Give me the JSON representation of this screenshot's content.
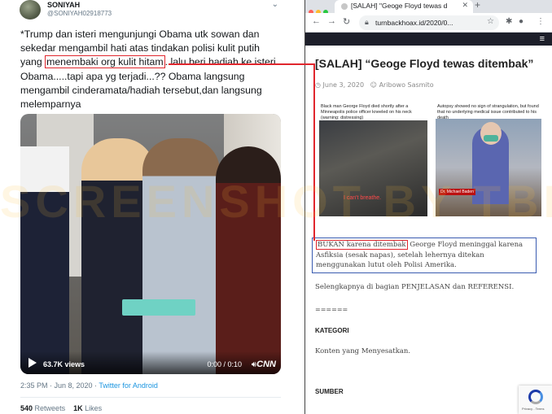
{
  "tweet": {
    "name": "SONIYAH",
    "handle": "@SONIYAH02918773",
    "menu_icon": "chevron-down-icon",
    "text_part1": "*Trump dan isteri mengunjungi Obama utk sowan dan sekedar mengambil hati atas tindakan polisi  kulit putih yang ",
    "text_highlight": "menembaki org kulit hitam",
    "text_part2": "..lalu beri hadiah ke isteri Obama.....tapi apa yg terjadi...?? Obama langsung mengambil cinderamata/hadiah tersebut,dan langsung melemparnya",
    "video": {
      "views": "63.7K views",
      "time": "0:00 / 0:10",
      "logo": "CNN"
    },
    "timestamp": "2:35 PM · Jun 8, 2020 · ",
    "source": "Twitter for Android",
    "retweets_count": "540",
    "retweets_label": "Retweets",
    "likes_count": "1K",
    "likes_label": "Likes"
  },
  "browser": {
    "tab_title": "[SALAH] \"Geoge Floyd tewas d",
    "url": "turnbackhoax.id/2020/0...",
    "window_dots": [
      "#ff5f57",
      "#febc2e",
      "#28c840"
    ]
  },
  "article": {
    "title": "[SALAH] “Geoge Floyd tewas ditembak”",
    "date": "June 3, 2020",
    "author": "Aribowo Sasmito",
    "img_left_caption": "Black man George Floyd died shortly after a Minneapolis police officer kneeled on his neck (warning: distressing)",
    "img_left_quote": "I can't breathe.",
    "img_right_caption": "Autopsy showed no sign of strangulation, but found that no underlying medical issue contributed to his death",
    "img_right_name": "Dr. Michael Baden",
    "excerpt_highlight": "BUKAN karena ditembak",
    "excerpt_rest": " George Floyd meninggal karena Asfiksia (sesak napas), setelah lehernya ditekan menggunakan lutut oleh Polisi Amerika.",
    "more": "Selengkapnya di bagian PENJELASAN dan REFERENSI.",
    "separator": "======",
    "category_heading": "KATEGORI",
    "category_value": "Konten yang Menyesatkan.",
    "source_heading": "SUMBER",
    "recaptcha_text": "Privacy - Terms"
  },
  "watermark": "SCREENSHOT BY TBH"
}
